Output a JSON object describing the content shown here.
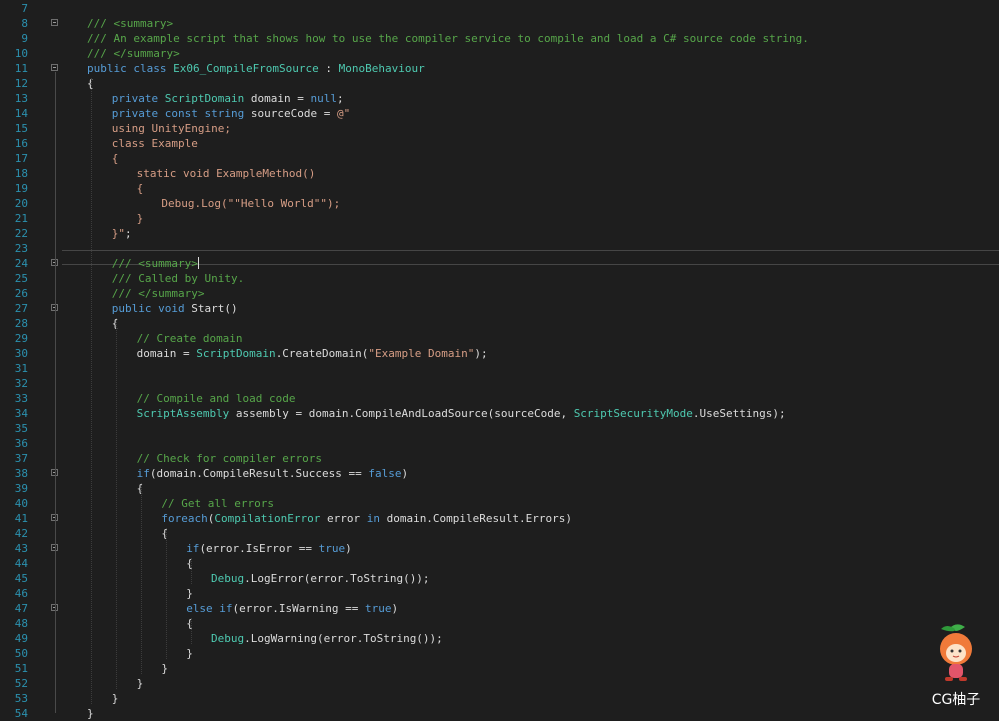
{
  "editor": {
    "colors": {
      "background": "#1e1e1e",
      "line_number": "#2b91af",
      "comment": "#57a64a",
      "keyword": "#569cd6",
      "type": "#4ec9b0",
      "string": "#d69d85",
      "text": "#dcdcdc"
    },
    "current_line": 24,
    "lines": [
      {
        "n": "7",
        "indent": 0,
        "fold": false,
        "tokens": []
      },
      {
        "n": "8",
        "indent": 1,
        "fold": true,
        "tokens": [
          {
            "t": "/// <summary>",
            "k": "comment"
          }
        ]
      },
      {
        "n": "9",
        "indent": 1,
        "fold": false,
        "tokens": [
          {
            "t": "/// An example script that shows how to use the compiler service to compile and load a C# source code string.",
            "k": "comment"
          }
        ]
      },
      {
        "n": "10",
        "indent": 1,
        "fold": false,
        "tokens": [
          {
            "t": "/// </summary>",
            "k": "comment"
          }
        ]
      },
      {
        "n": "11",
        "indent": 1,
        "fold": true,
        "tokens": [
          {
            "t": "public class ",
            "k": "keyword"
          },
          {
            "t": "Ex06_CompileFromSource",
            "k": "type"
          },
          {
            "t": " : ",
            "k": "plain"
          },
          {
            "t": "MonoBehaviour",
            "k": "type"
          }
        ]
      },
      {
        "n": "12",
        "indent": 1,
        "fold": false,
        "tokens": [
          {
            "t": "{",
            "k": "plain"
          }
        ]
      },
      {
        "n": "13",
        "indent": 2,
        "fold": false,
        "tokens": [
          {
            "t": "private ",
            "k": "keyword"
          },
          {
            "t": "ScriptDomain",
            "k": "type"
          },
          {
            "t": " domain = ",
            "k": "plain"
          },
          {
            "t": "null",
            "k": "keyword"
          },
          {
            "t": ";",
            "k": "plain"
          }
        ]
      },
      {
        "n": "14",
        "indent": 2,
        "fold": false,
        "tokens": [
          {
            "t": "private const string ",
            "k": "keyword"
          },
          {
            "t": "sourceCode = ",
            "k": "plain"
          },
          {
            "t": "@\"",
            "k": "string"
          }
        ]
      },
      {
        "n": "15",
        "indent": 2,
        "fold": false,
        "tokens": [
          {
            "t": "using UnityEngine;",
            "k": "string"
          }
        ]
      },
      {
        "n": "16",
        "indent": 2,
        "fold": false,
        "tokens": [
          {
            "t": "class Example",
            "k": "string"
          }
        ]
      },
      {
        "n": "17",
        "indent": 2,
        "fold": false,
        "tokens": [
          {
            "t": "{",
            "k": "string"
          }
        ]
      },
      {
        "n": "18",
        "indent": 3,
        "fold": false,
        "tokens": [
          {
            "t": "static void ExampleMethod()",
            "k": "string"
          }
        ]
      },
      {
        "n": "19",
        "indent": 3,
        "fold": false,
        "tokens": [
          {
            "t": "{",
            "k": "string"
          }
        ]
      },
      {
        "n": "20",
        "indent": 4,
        "fold": false,
        "tokens": [
          {
            "t": "Debug.Log(\"\"Hello World\"\");",
            "k": "string"
          }
        ]
      },
      {
        "n": "21",
        "indent": 3,
        "fold": false,
        "tokens": [
          {
            "t": "}",
            "k": "string"
          }
        ]
      },
      {
        "n": "22",
        "indent": 2,
        "fold": false,
        "tokens": [
          {
            "t": "}\"",
            "k": "string"
          },
          {
            "t": ";",
            "k": "plain"
          }
        ]
      },
      {
        "n": "23",
        "indent": 0,
        "fold": false,
        "tokens": []
      },
      {
        "n": "24",
        "indent": 2,
        "fold": true,
        "cursor": true,
        "tokens": [
          {
            "t": "/// <summary>",
            "k": "comment"
          }
        ]
      },
      {
        "n": "25",
        "indent": 2,
        "fold": false,
        "tokens": [
          {
            "t": "/// Called by Unity.",
            "k": "comment"
          }
        ]
      },
      {
        "n": "26",
        "indent": 2,
        "fold": false,
        "tokens": [
          {
            "t": "/// </summary>",
            "k": "comment"
          }
        ]
      },
      {
        "n": "27",
        "indent": 2,
        "fold": true,
        "tokens": [
          {
            "t": "public void ",
            "k": "keyword"
          },
          {
            "t": "Start()",
            "k": "plain"
          }
        ]
      },
      {
        "n": "28",
        "indent": 2,
        "fold": false,
        "tokens": [
          {
            "t": "{",
            "k": "plain"
          }
        ]
      },
      {
        "n": "29",
        "indent": 3,
        "fold": false,
        "tokens": [
          {
            "t": "// Create domain",
            "k": "comment"
          }
        ]
      },
      {
        "n": "30",
        "indent": 3,
        "fold": false,
        "tokens": [
          {
            "t": "domain = ",
            "k": "plain"
          },
          {
            "t": "ScriptDomain",
            "k": "type"
          },
          {
            "t": ".CreateDomain(",
            "k": "plain"
          },
          {
            "t": "\"Example Domain\"",
            "k": "string"
          },
          {
            "t": ");",
            "k": "plain"
          }
        ]
      },
      {
        "n": "31",
        "indent": 0,
        "fold": false,
        "tokens": []
      },
      {
        "n": "32",
        "indent": 0,
        "fold": false,
        "tokens": []
      },
      {
        "n": "33",
        "indent": 3,
        "fold": false,
        "tokens": [
          {
            "t": "// Compile and load code",
            "k": "comment"
          }
        ]
      },
      {
        "n": "34",
        "indent": 3,
        "fold": false,
        "tokens": [
          {
            "t": "ScriptAssembly",
            "k": "type"
          },
          {
            "t": " assembly = domain.CompileAndLoadSource(sourceCode, ",
            "k": "plain"
          },
          {
            "t": "ScriptSecurityMode",
            "k": "type"
          },
          {
            "t": ".UseSettings);",
            "k": "plain"
          }
        ]
      },
      {
        "n": "35",
        "indent": 0,
        "fold": false,
        "tokens": []
      },
      {
        "n": "36",
        "indent": 0,
        "fold": false,
        "tokens": []
      },
      {
        "n": "37",
        "indent": 3,
        "fold": false,
        "tokens": [
          {
            "t": "// Check for compiler errors",
            "k": "comment"
          }
        ]
      },
      {
        "n": "38",
        "indent": 3,
        "fold": true,
        "tokens": [
          {
            "t": "if",
            "k": "keyword"
          },
          {
            "t": "(domain.CompileResult.Success == ",
            "k": "plain"
          },
          {
            "t": "false",
            "k": "keyword"
          },
          {
            "t": ")",
            "k": "plain"
          }
        ]
      },
      {
        "n": "39",
        "indent": 3,
        "fold": false,
        "tokens": [
          {
            "t": "{",
            "k": "plain"
          }
        ]
      },
      {
        "n": "40",
        "indent": 4,
        "fold": false,
        "tokens": [
          {
            "t": "// Get all errors",
            "k": "comment"
          }
        ]
      },
      {
        "n": "41",
        "indent": 4,
        "fold": true,
        "tokens": [
          {
            "t": "foreach",
            "k": "keyword"
          },
          {
            "t": "(",
            "k": "plain"
          },
          {
            "t": "CompilationError",
            "k": "type"
          },
          {
            "t": " error ",
            "k": "plain"
          },
          {
            "t": "in",
            "k": "keyword"
          },
          {
            "t": " domain.CompileResult.Errors)",
            "k": "plain"
          }
        ]
      },
      {
        "n": "42",
        "indent": 4,
        "fold": false,
        "tokens": [
          {
            "t": "{",
            "k": "plain"
          }
        ]
      },
      {
        "n": "43",
        "indent": 5,
        "fold": true,
        "tokens": [
          {
            "t": "if",
            "k": "keyword"
          },
          {
            "t": "(error.IsError == ",
            "k": "plain"
          },
          {
            "t": "true",
            "k": "keyword"
          },
          {
            "t": ")",
            "k": "plain"
          }
        ]
      },
      {
        "n": "44",
        "indent": 5,
        "fold": false,
        "tokens": [
          {
            "t": "{",
            "k": "plain"
          }
        ]
      },
      {
        "n": "45",
        "indent": 6,
        "fold": false,
        "tokens": [
          {
            "t": "Debug",
            "k": "type"
          },
          {
            "t": ".LogError(error.ToString());",
            "k": "plain"
          }
        ]
      },
      {
        "n": "46",
        "indent": 5,
        "fold": false,
        "tokens": [
          {
            "t": "}",
            "k": "plain"
          }
        ]
      },
      {
        "n": "47",
        "indent": 5,
        "fold": true,
        "tokens": [
          {
            "t": "else if",
            "k": "keyword"
          },
          {
            "t": "(error.IsWarning == ",
            "k": "plain"
          },
          {
            "t": "true",
            "k": "keyword"
          },
          {
            "t": ")",
            "k": "plain"
          }
        ]
      },
      {
        "n": "48",
        "indent": 5,
        "fold": false,
        "tokens": [
          {
            "t": "{",
            "k": "plain"
          }
        ]
      },
      {
        "n": "49",
        "indent": 6,
        "fold": false,
        "tokens": [
          {
            "t": "Debug",
            "k": "type"
          },
          {
            "t": ".LogWarning(error.ToString());",
            "k": "plain"
          }
        ]
      },
      {
        "n": "50",
        "indent": 5,
        "fold": false,
        "tokens": [
          {
            "t": "}",
            "k": "plain"
          }
        ]
      },
      {
        "n": "51",
        "indent": 4,
        "fold": false,
        "tokens": [
          {
            "t": "}",
            "k": "plain"
          }
        ]
      },
      {
        "n": "52",
        "indent": 3,
        "fold": false,
        "tokens": [
          {
            "t": "}",
            "k": "plain"
          }
        ]
      },
      {
        "n": "53",
        "indent": 2,
        "fold": false,
        "tokens": [
          {
            "t": "}",
            "k": "plain"
          }
        ]
      },
      {
        "n": "54",
        "indent": 1,
        "fold": false,
        "tokens": [
          {
            "t": "}",
            "k": "plain"
          }
        ]
      }
    ]
  },
  "watermark": {
    "text": "CG柚子",
    "icon": "orange-mascot-icon"
  }
}
